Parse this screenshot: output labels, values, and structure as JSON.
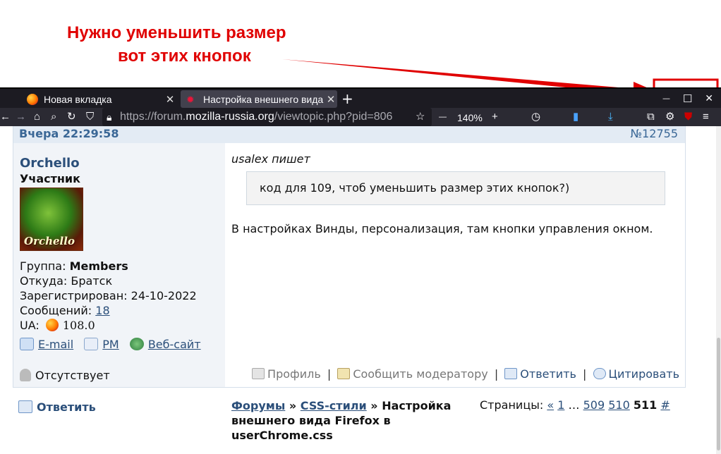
{
  "annotation": {
    "line1": "Нужно уменьшить размер",
    "line2": "вот этих кнопок",
    "color": "#e00000"
  },
  "tabs": [
    {
      "title": "Новая вкладка",
      "icon": "firefox-icon"
    },
    {
      "title": "Настройка внешнего вида Firefox в userChrome.css",
      "icon": "forum-bug-icon",
      "active": true
    }
  ],
  "window_controls": {
    "minimize": "—",
    "maximize": "☐",
    "close": "✕"
  },
  "navbar": {
    "url_prefix": "https://forum.",
    "url_host": "mozilla-russia.org",
    "url_rest": "/viewtopic.php?pid=806",
    "zoom_minus": "—",
    "zoom": "140%",
    "zoom_plus": "+"
  },
  "post": {
    "time": "Вчера 22:29:58",
    "number": "№12755",
    "user": {
      "name": "Orchello",
      "rank": "Участник",
      "avatar_text": "Orchello",
      "group_label": "Группа: ",
      "group": "Members",
      "from": "Откуда: Братск",
      "registered": "Зарегистрирован: 24-10-2022",
      "messages_label": "Сообщений: ",
      "messages": "18",
      "ua_label": "UA: ",
      "ua": "108.0",
      "email": "E-mail",
      "pm": "PM",
      "website": "Веб-сайт",
      "status": "Отсутствует"
    },
    "quote_author": "usalex пишет",
    "quote_text": "код для 109, чтоб уменьшить размер этих кнопок?)",
    "text": "В настройках Винды, персонализация, там кнопки управления окном.",
    "footer": {
      "profile": "Профиль",
      "report": "Сообщить модератору",
      "reply": "Ответить",
      "quote": "Цитировать",
      "sep": "|"
    }
  },
  "bottom": {
    "reply": "Ответить",
    "crumb_forums": "Форумы",
    "crumb_sep": "»",
    "crumb_section": "CSS-стили",
    "crumb_topic": "Настройка внешнего вида Firefox в userChrome.css",
    "pages_label": "Страницы:",
    "prev": "«",
    "p1": "1",
    "ellipsis": "…",
    "p509": "509",
    "p510": "510",
    "p511": "511",
    "hash": "#"
  }
}
